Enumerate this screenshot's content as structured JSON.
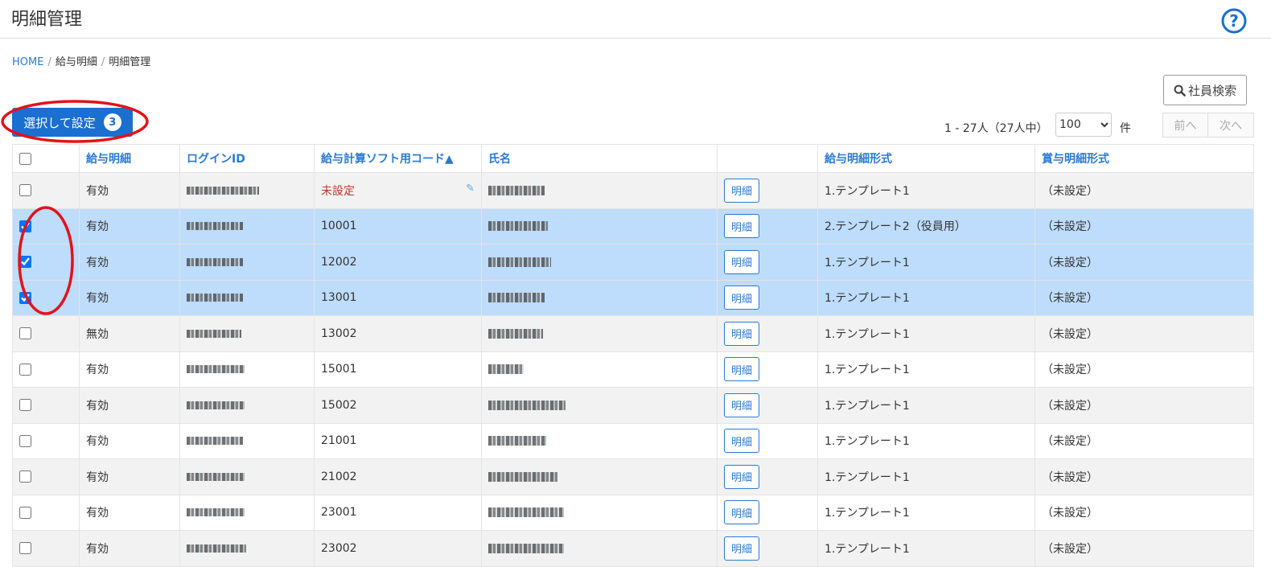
{
  "header": {
    "title": "明細管理",
    "help_icon": "question-circle-icon",
    "accent_color": "#1a6fd0"
  },
  "breadcrumb": [
    {
      "label": "HOME",
      "link": true
    },
    {
      "label": "給与明細",
      "link": false
    },
    {
      "label": "明細管理",
      "link": false
    }
  ],
  "breadcrumb_separator": "/",
  "toolbar": {
    "search_label": "社員検索",
    "search_icon": "search-icon",
    "select_set_label": "選択して設定",
    "selected_count": "3",
    "count_text": "1 - 27人（27人中）",
    "per_page_value": "100",
    "per_page_unit": "件",
    "prev_label": "前へ",
    "next_label": "次へ"
  },
  "table": {
    "headers": [
      "給与明細",
      "ログインID",
      "給与計算ソフト用コード▲",
      "氏名",
      "",
      "給与明細形式",
      "賞与明細形式"
    ],
    "detail_button_label": "明細",
    "rows": [
      {
        "checked": false,
        "status": "有効",
        "code": "未設定",
        "payslip_format": "1.テンプレート1",
        "bonus_format": "（未設定）"
      },
      {
        "checked": true,
        "status": "有効",
        "code": "10001",
        "payslip_format": "2.テンプレート2（役員用）",
        "bonus_format": "（未設定）"
      },
      {
        "checked": true,
        "status": "有効",
        "code": "12002",
        "payslip_format": "1.テンプレート1",
        "bonus_format": "（未設定）"
      },
      {
        "checked": true,
        "status": "有効",
        "code": "13001",
        "payslip_format": "1.テンプレート1",
        "bonus_format": "（未設定）"
      },
      {
        "checked": false,
        "status": "無効",
        "code": "13002",
        "payslip_format": "1.テンプレート1",
        "bonus_format": "（未設定）"
      },
      {
        "checked": false,
        "status": "有効",
        "code": "15001",
        "payslip_format": "1.テンプレート1",
        "bonus_format": "（未設定）"
      },
      {
        "checked": false,
        "status": "有効",
        "code": "15002",
        "payslip_format": "1.テンプレート1",
        "bonus_format": "（未設定）"
      },
      {
        "checked": false,
        "status": "有効",
        "code": "21001",
        "payslip_format": "1.テンプレート1",
        "bonus_format": "（未設定）"
      },
      {
        "checked": false,
        "status": "有効",
        "code": "21002",
        "payslip_format": "1.テンプレート1",
        "bonus_format": "（未設定）"
      },
      {
        "checked": false,
        "status": "有効",
        "code": "23001",
        "payslip_format": "1.テンプレート1",
        "bonus_format": "（未設定）"
      },
      {
        "checked": false,
        "status": "有効",
        "code": "23002",
        "payslip_format": "1.テンプレート1",
        "bonus_format": "（未設定）"
      }
    ]
  },
  "colors": {
    "selected_row": "#bedcfc",
    "link": "#2a7ad2",
    "warning": "#c0392b",
    "annotation": "#e3121b"
  }
}
